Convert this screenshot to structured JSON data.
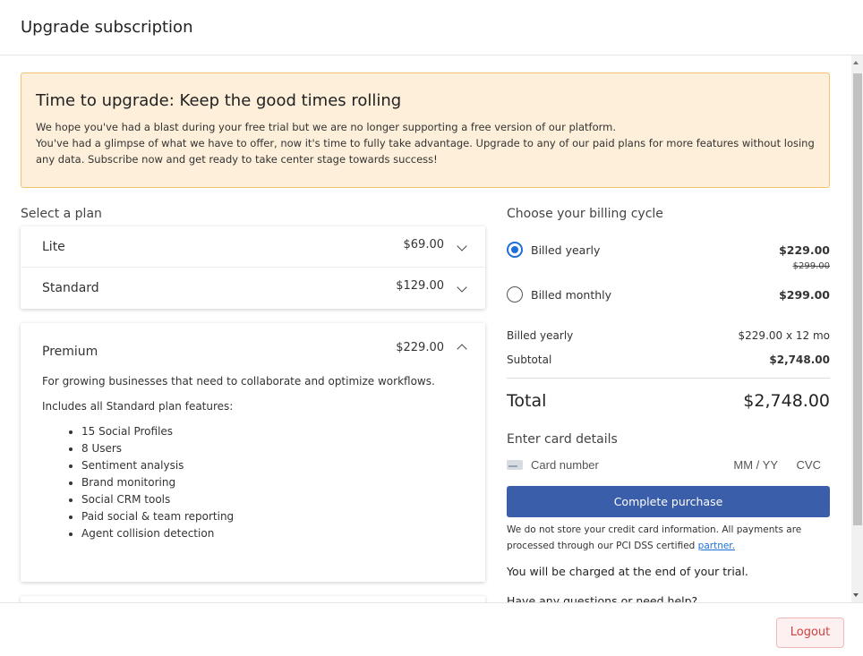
{
  "modal": {
    "title": "Upgrade subscription"
  },
  "alert": {
    "title": "Time to upgrade: Keep the good times rolling",
    "line1": "We hope you've had a blast during your free trial but we are no longer supporting a free version of our platform.",
    "line2": "You've had a glimpse of what we have to offer, now it's time to fully take advantage. Upgrade to any of our paid plans for more features without losing any data. Subscribe now and get ready to take center stage towards success!"
  },
  "plans": {
    "section_label": "Select a plan",
    "lite": {
      "name": "Lite",
      "price": "$69.00"
    },
    "standard": {
      "name": "Standard",
      "price": "$129.00"
    },
    "premium": {
      "name": "Premium",
      "price": "$229.00",
      "description": "For growing businesses that need to collaborate and optimize workflows.",
      "includes": "Includes all Standard plan features:",
      "features": [
        "15 Social Profiles",
        "8 Users",
        "Sentiment analysis",
        "Brand monitoring",
        "Social CRM tools",
        "Paid social & team reporting",
        "Agent collision detection"
      ]
    }
  },
  "billing": {
    "section_label": "Choose your billing cycle",
    "yearly": {
      "label": "Billed yearly",
      "price": "$229.00",
      "original_price": "$299.00",
      "selected": true
    },
    "monthly": {
      "label": "Billed monthly",
      "price": "$299.00",
      "selected": false
    }
  },
  "summary": {
    "billed_label": "Billed yearly",
    "billed_value": "$229.00 x 12 mo",
    "subtotal_label": "Subtotal",
    "subtotal_value": "$2,748.00",
    "total_label": "Total",
    "total_value": "$2,748.00"
  },
  "card": {
    "section_label": "Enter card details",
    "number_placeholder": "Card number",
    "expiry_placeholder": "MM / YY",
    "cvc_placeholder": "CVC"
  },
  "purchase": {
    "button_label": "Complete purchase",
    "note_text": "We do not store your credit card information. All payments are processed through our PCI DSS certified ",
    "note_link": "partner.",
    "charge_note": "You will be charged at the end of your trial.",
    "help_text": "Have any questions or need help?"
  },
  "footer": {
    "logout_label": "Logout"
  },
  "colors": {
    "primary": "#3a5ea9",
    "radio_selected": "#1e6fd9",
    "alert_bg": "#fdefd9",
    "alert_border": "#f3c36e",
    "danger": "#d44040"
  }
}
